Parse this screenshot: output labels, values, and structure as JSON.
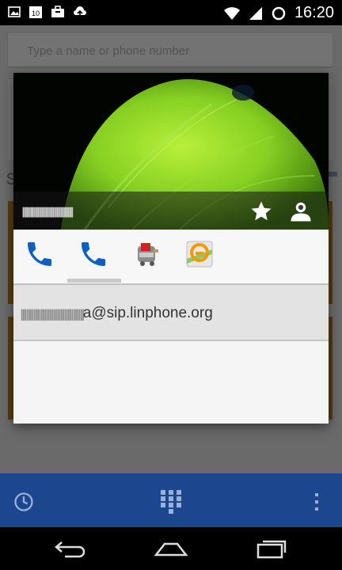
{
  "status_bar": {
    "time": "16:20",
    "left_icons": [
      "image-icon",
      "calendar-10-icon",
      "briefcase-icon",
      "upload-icon"
    ],
    "right_icons": [
      "wifi-icon",
      "signal-icon",
      "sync-icon"
    ]
  },
  "background": {
    "search_placeholder": "Type a name or phone number",
    "section_letter": "S"
  },
  "contact_card": {
    "name": "ꞁꞁꞁꞁꞁꞁꞁꞁꞁꞁꞁꞁꞁꞁꞁꞁꞁꞁꞁꞁꞁꞁꞁꞁꞁꞁꞁꞁꞁꞁꞁꞁꞁꞁꞁꞁꞁ",
    "actions": [
      {
        "name": "call-icon",
        "color": "#0d5fc1"
      },
      {
        "name": "call-icon",
        "color": "#0d5fc1"
      },
      {
        "name": "hangouts-icon",
        "color": "#cc2222"
      },
      {
        "name": "maps-icon",
        "color": "#f0a000"
      }
    ],
    "address_blurred": "ꞁꞁꞁꞁꞁꞁꞁꞁꞁꞁꞁꞁꞁꞁꞁꞁꞁꞁꞁꞁꞁꞁꞁꞁꞁꞁꞁꞁꞁꞁꞁꞁꞁꞁꞁ",
    "address_visible": "a@sip.linphone.org"
  },
  "bottom_bar": {
    "color": "#1c478f",
    "icons": [
      "history-icon",
      "dialpad-icon",
      "overflow-menu-icon"
    ]
  },
  "nav_bar": {
    "icons": [
      "back-icon",
      "home-icon",
      "recents-icon"
    ]
  }
}
